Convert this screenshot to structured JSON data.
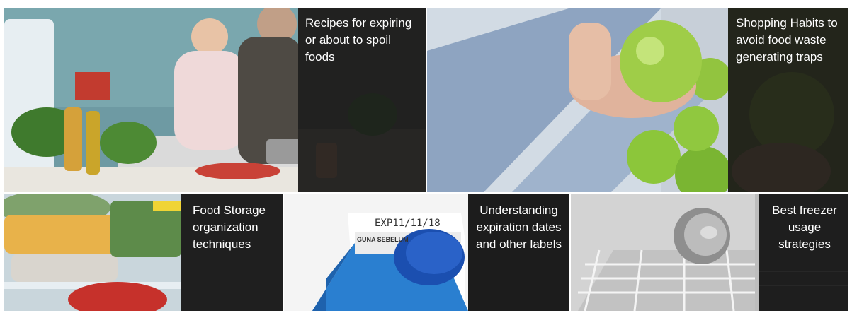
{
  "tiles": {
    "recipes": {
      "label": "Recipes for expiring or about to spoil foods"
    },
    "shopping": {
      "label": "Shopping Habits to avoid food waste generating traps"
    },
    "storage": {
      "label": "Food Storage organization techniques"
    },
    "expiration": {
      "label": "Understanding expiration dates and other labels"
    },
    "freezer": {
      "label": "Best freezer usage strategies"
    }
  },
  "carton": {
    "exp_text": "EXP11/11/18",
    "brand_text": "GUNA SEBELUM"
  },
  "colors": {
    "overlay": "#1e1e1e",
    "text": "#ffffff",
    "carton_blue": "#2a7fd0"
  }
}
